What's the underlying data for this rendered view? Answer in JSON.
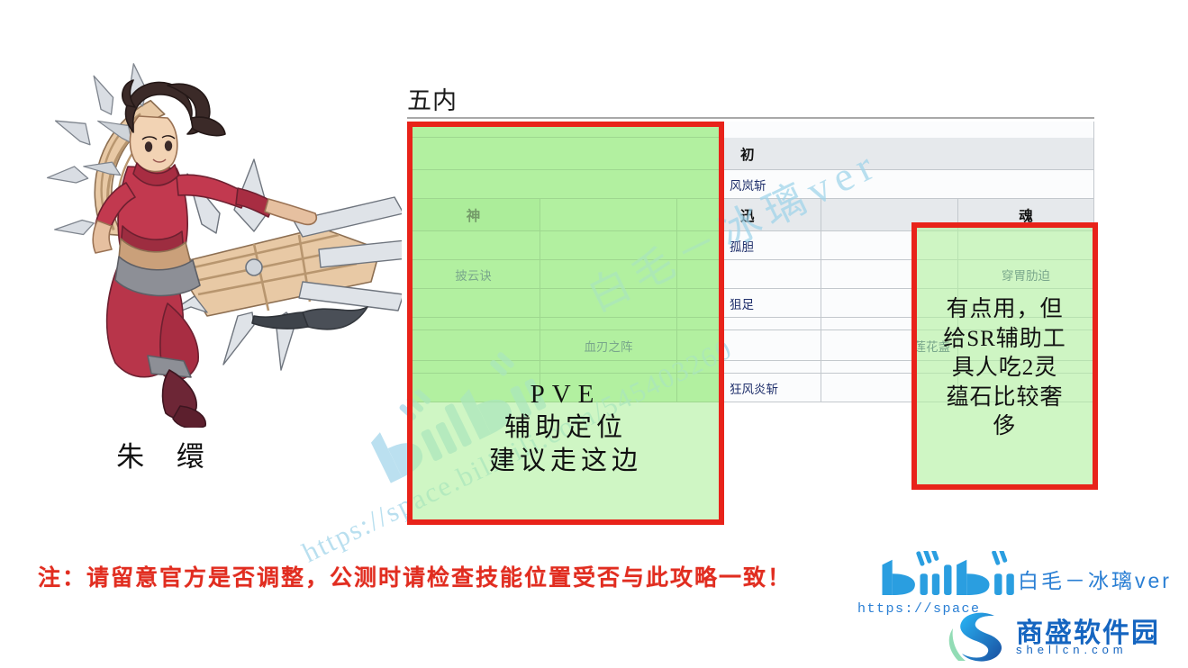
{
  "character": {
    "name": "朱 缳",
    "art_alt": "朱缳 character illustration"
  },
  "section": {
    "title": "五内"
  },
  "table": {
    "columns": [
      "神",
      "col2",
      "col3",
      "迅",
      "col5",
      "魂"
    ],
    "headers": {
      "chu": "初",
      "shen": "神",
      "xun": "迅",
      "hun": "魂"
    },
    "skills": {
      "feng_lan_zhan": "风岚斩",
      "gu_dan": "孤胆",
      "ju_zu": "狙足",
      "lian_hua_zhan": "莲花盏",
      "kuang_feng_yan_zhan": "狂风炎斩",
      "pi_yun_jue": "披云诀",
      "xue_ren_zhi_zhen": "血刃之阵",
      "chuan_wei_lei_po": "穿胃肋迫"
    }
  },
  "annotations": {
    "left_box": {
      "line1": "PVE",
      "line2": "辅助定位",
      "line3": "建议走这边"
    },
    "right_box": {
      "line1": "有点用，但",
      "line2": "给SR辅助工",
      "line3": "具人吃2灵",
      "line4": "蕴石比较奢",
      "line5": "侈"
    }
  },
  "footer": {
    "warning": "注：请留意官方是否调整，公测时请检查技能位置受否与此攻略一致！"
  },
  "brand": {
    "logo_text": "bilibili",
    "author": "白毛－冰璃ver",
    "url": "https://space"
  },
  "watermark": {
    "author": "白毛－冰璃ver",
    "url": "https://space.bilibili.com/545403260",
    "logo": "bilibili"
  },
  "shellcn": {
    "name": "商盛软件园",
    "url": "shellcn.com"
  },
  "colors": {
    "highlight_border": "#e8231a",
    "highlight_fill": "#b2f0a0",
    "warning_text": "#e12d20",
    "brand_blue": "#2a7fd4",
    "watermark_blue": "#9fd4ea",
    "header_gray": "#e6e9ec",
    "cell_text": "#1f2f6b"
  }
}
